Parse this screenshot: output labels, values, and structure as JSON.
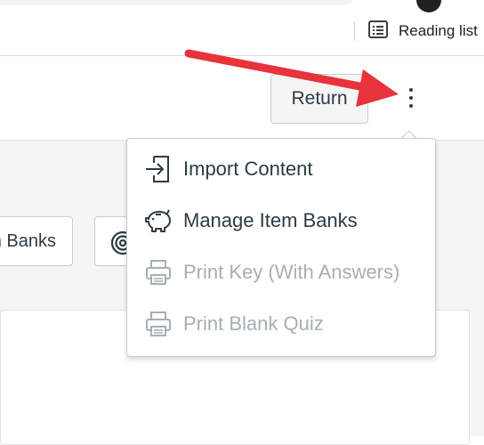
{
  "browser": {
    "bookmarks_bar": {
      "reading_list_label": "Reading list",
      "reading_list_icon": "reading-list-icon"
    }
  },
  "header": {
    "return_label": "Return",
    "more_options_icon": "kebab-icon"
  },
  "toolbar": {
    "banks_button_label": "n Banks",
    "second_button_icon": "target-icon"
  },
  "options_menu": {
    "items": [
      {
        "label": "Import Content",
        "icon": "import-icon",
        "enabled": true
      },
      {
        "label": "Manage Item Banks",
        "icon": "piggy-bank-icon",
        "enabled": true
      },
      {
        "label": "Print Key (With Answers)",
        "icon": "printer-icon",
        "enabled": false
      },
      {
        "label": "Print Blank Quiz",
        "icon": "printer-icon",
        "enabled": false
      }
    ]
  },
  "annotation": {
    "arrow_color": "#e8323c"
  },
  "colors": {
    "text": "#2d3b45",
    "disabled_text": "#a5afb5",
    "border": "#c7cdd1",
    "content_bg": "#f5f5f5"
  }
}
